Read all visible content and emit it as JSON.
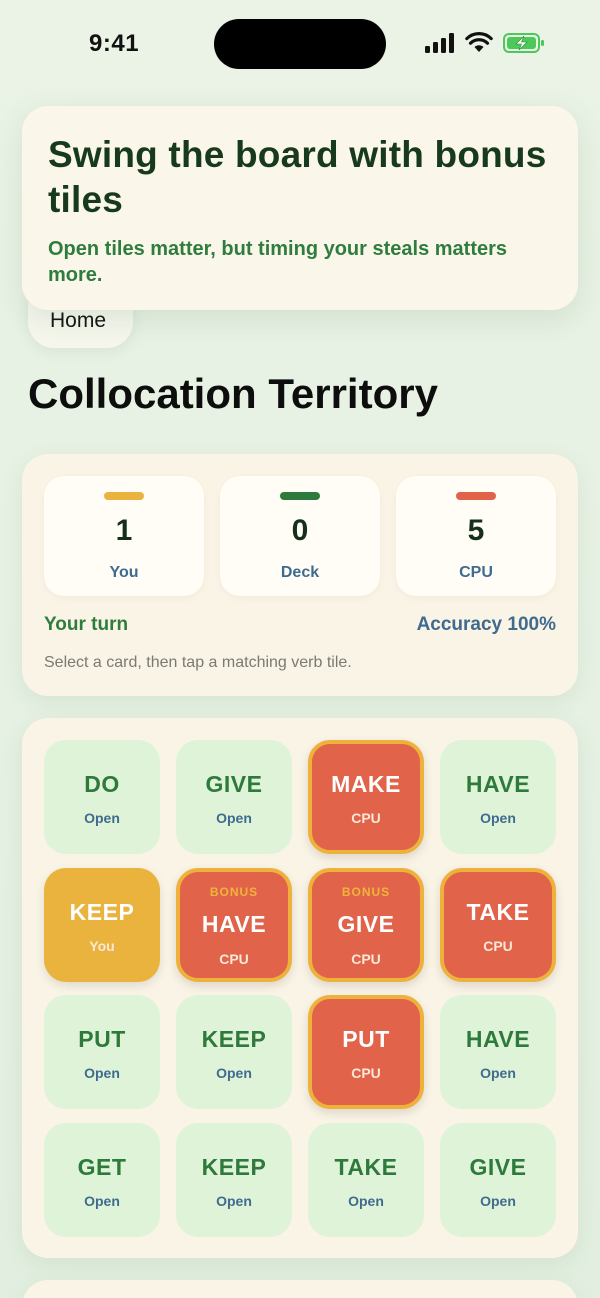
{
  "status": {
    "time": "9:41"
  },
  "toast": {
    "title": "Swing the board with bonus tiles",
    "subtitle": "Open tiles matter, but timing your steals matters more."
  },
  "nav": {
    "home_label": "Home"
  },
  "page": {
    "title": "Collocation Territory"
  },
  "scores": [
    {
      "value": "1",
      "label": "You",
      "color": "#e9b33e"
    },
    {
      "value": "0",
      "label": "Deck",
      "color": "#2e7a3c"
    },
    {
      "value": "5",
      "label": "CPU",
      "color": "#e0634a"
    }
  ],
  "game": {
    "turn": "Your turn",
    "accuracy": "Accuracy 100%",
    "hint": "Select a card, then tap a matching verb tile."
  },
  "board": {
    "tiles": [
      {
        "verb": "DO",
        "owner": "Open",
        "state": "open"
      },
      {
        "verb": "GIVE",
        "owner": "Open",
        "state": "open"
      },
      {
        "verb": "MAKE",
        "owner": "CPU",
        "state": "cpu"
      },
      {
        "verb": "HAVE",
        "owner": "Open",
        "state": "open"
      },
      {
        "verb": "KEEP",
        "owner": "You",
        "state": "you"
      },
      {
        "verb": "HAVE",
        "owner": "CPU",
        "state": "cpu",
        "bonus": "BONUS"
      },
      {
        "verb": "GIVE",
        "owner": "CPU",
        "state": "cpu",
        "bonus": "BONUS"
      },
      {
        "verb": "TAKE",
        "owner": "CPU",
        "state": "cpu"
      },
      {
        "verb": "PUT",
        "owner": "Open",
        "state": "open"
      },
      {
        "verb": "KEEP",
        "owner": "Open",
        "state": "open"
      },
      {
        "verb": "PUT",
        "owner": "CPU",
        "state": "cpu"
      },
      {
        "verb": "HAVE",
        "owner": "Open",
        "state": "open"
      },
      {
        "verb": "GET",
        "owner": "Open",
        "state": "open"
      },
      {
        "verb": "KEEP",
        "owner": "Open",
        "state": "open"
      },
      {
        "verb": "TAKE",
        "owner": "Open",
        "state": "open"
      },
      {
        "verb": "GIVE",
        "owner": "Open",
        "state": "open"
      }
    ]
  },
  "icons": [
    "signal-icon",
    "wifi-icon",
    "battery-charging-icon"
  ]
}
